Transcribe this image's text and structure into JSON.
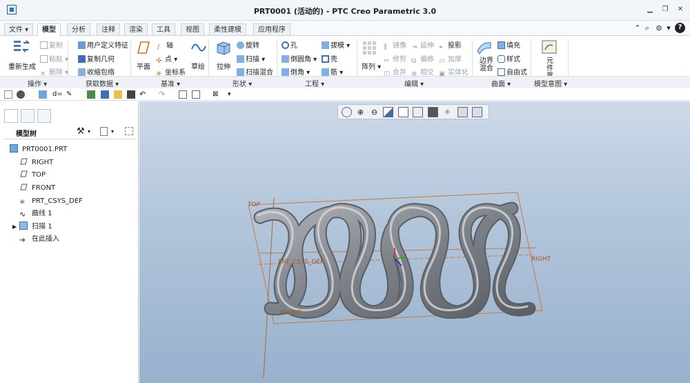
{
  "window": {
    "title": "PRT0001 (活动的) - PTC Creo Parametric 3.0"
  },
  "tabs": [
    {
      "label": "文件"
    },
    {
      "label": "模型"
    },
    {
      "label": "分析"
    },
    {
      "label": "注释"
    },
    {
      "label": "渲染"
    },
    {
      "label": "工具"
    },
    {
      "label": "视图"
    },
    {
      "label": "柔性建模"
    },
    {
      "label": "应用程序"
    }
  ],
  "ribbon": {
    "groups": [
      {
        "label": "操作"
      },
      {
        "label": "获取数据"
      },
      {
        "label": "基准"
      },
      {
        "label": "形状"
      },
      {
        "label": "工程"
      },
      {
        "label": "编辑"
      },
      {
        "label": "曲面"
      },
      {
        "label": "模型意图"
      }
    ],
    "buttons": {
      "regenerate": "重新生成",
      "copy": "复制",
      "paste": "粘贴",
      "delete": "删除",
      "udf": "用户定义特征",
      "copy_geom": "复制几何",
      "shrinkwrap": "收缩包络",
      "plane": "平面",
      "axis": "轴",
      "point": "点",
      "csys": "坐标系",
      "sketch": "草绘",
      "extrude": "拉伸",
      "revolve": "旋转",
      "sweep": "扫描",
      "swept_blend": "扫描混合",
      "hole": "孔",
      "round": "倒圆角",
      "chamfer": "倒角",
      "draft": "拔模",
      "shell": "壳",
      "rib": "筋",
      "pattern": "阵列",
      "mirror": "镜像",
      "extend": "延伸",
      "project": "投影",
      "trim": "修剪",
      "offset": "偏移",
      "thicken": "加厚",
      "merge": "合并",
      "intersect": "相交",
      "solidify": "实体化",
      "boundary_blend": "边界混合",
      "fill": "填充",
      "style": "样式",
      "freestyle": "自由式",
      "component_interface": "元件界面"
    }
  },
  "model_tree": {
    "title": "模型树",
    "items": [
      {
        "label": "PRT0001.PRT"
      },
      {
        "label": "RIGHT"
      },
      {
        "label": "TOP"
      },
      {
        "label": "FRONT"
      },
      {
        "label": "PRT_CSYS_DEF"
      },
      {
        "label": "曲线 1"
      },
      {
        "label": "扫描 1"
      },
      {
        "label": "在此插入"
      }
    ]
  },
  "viewport": {
    "datum_labels": {
      "top": "TOP",
      "right": "RIGHT",
      "front": "FRONT",
      "csys": "PRT_CSYS_DEF"
    }
  },
  "colors": {
    "accent": "#2a6fc2",
    "datum_orange": "#c8783a",
    "model_gray": "#7d8188"
  }
}
